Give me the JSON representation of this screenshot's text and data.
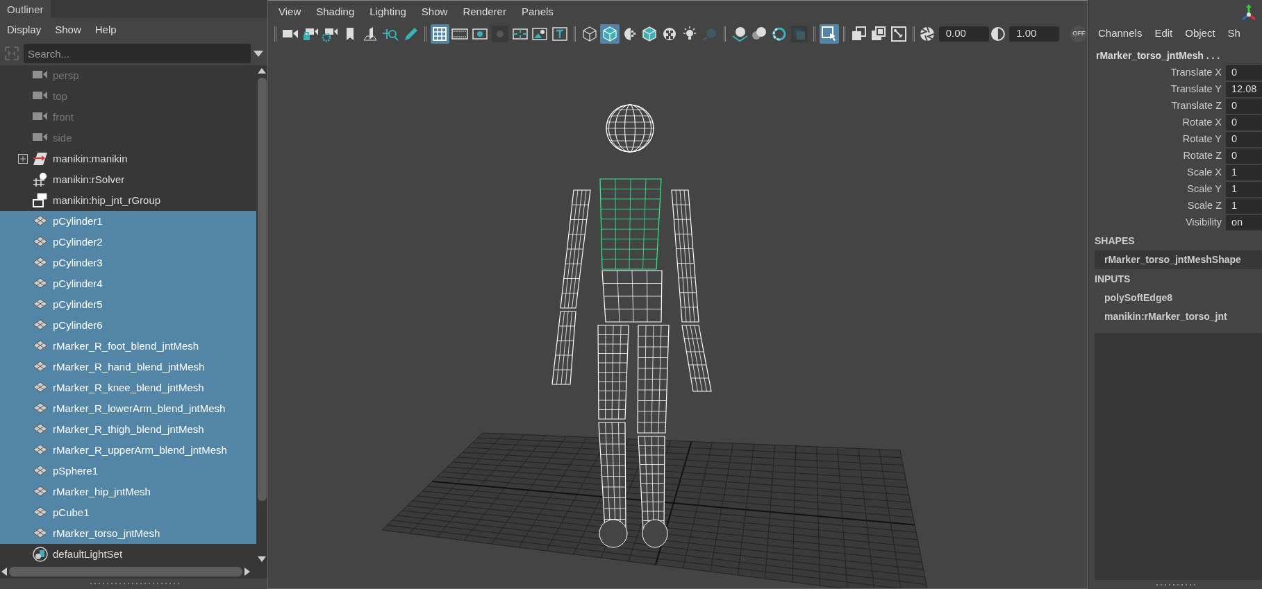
{
  "outliner": {
    "title": "Outliner",
    "menu": [
      "Display",
      "Show",
      "Help"
    ],
    "search": {
      "placeholder": "Search..."
    },
    "items": [
      {
        "label": "persp",
        "kind": "camera",
        "dimmed": true,
        "has_children": false,
        "selected": false
      },
      {
        "label": "top",
        "kind": "camera",
        "dimmed": true,
        "has_children": false,
        "selected": false
      },
      {
        "label": "front",
        "kind": "camera",
        "dimmed": true,
        "has_children": false,
        "selected": false
      },
      {
        "label": "side",
        "kind": "camera",
        "dimmed": true,
        "has_children": false,
        "selected": false
      },
      {
        "label": "manikin:manikin",
        "kind": "locator",
        "dimmed": false,
        "has_children": true,
        "selected": false
      },
      {
        "label": "manikin:rSolver",
        "kind": "solver",
        "dimmed": false,
        "has_children": false,
        "selected": false
      },
      {
        "label": "manikin:hip_jnt_rGroup",
        "kind": "group",
        "dimmed": false,
        "has_children": false,
        "selected": false
      },
      {
        "label": "pCylinder1",
        "kind": "mesh",
        "dimmed": false,
        "has_children": false,
        "selected": true
      },
      {
        "label": "pCylinder2",
        "kind": "mesh",
        "dimmed": false,
        "has_children": false,
        "selected": true
      },
      {
        "label": "pCylinder3",
        "kind": "mesh",
        "dimmed": false,
        "has_children": false,
        "selected": true
      },
      {
        "label": "pCylinder4",
        "kind": "mesh",
        "dimmed": false,
        "has_children": false,
        "selected": true
      },
      {
        "label": "pCylinder5",
        "kind": "mesh",
        "dimmed": false,
        "has_children": false,
        "selected": true
      },
      {
        "label": "pCylinder6",
        "kind": "mesh",
        "dimmed": false,
        "has_children": false,
        "selected": true
      },
      {
        "label": "rMarker_R_foot_blend_jntMesh",
        "kind": "mesh",
        "dimmed": false,
        "has_children": false,
        "selected": true
      },
      {
        "label": "rMarker_R_hand_blend_jntMesh",
        "kind": "mesh",
        "dimmed": false,
        "has_children": false,
        "selected": true
      },
      {
        "label": "rMarker_R_knee_blend_jntMesh",
        "kind": "mesh",
        "dimmed": false,
        "has_children": false,
        "selected": true
      },
      {
        "label": "rMarker_R_lowerArm_blend_jntMesh",
        "kind": "mesh",
        "dimmed": false,
        "has_children": false,
        "selected": true
      },
      {
        "label": "rMarker_R_thigh_blend_jntMesh",
        "kind": "mesh",
        "dimmed": false,
        "has_children": false,
        "selected": true
      },
      {
        "label": "rMarker_R_upperArm_blend_jntMesh",
        "kind": "mesh",
        "dimmed": false,
        "has_children": false,
        "selected": true
      },
      {
        "label": "pSphere1",
        "kind": "mesh",
        "dimmed": false,
        "has_children": false,
        "selected": true
      },
      {
        "label": "rMarker_hip_jntMesh",
        "kind": "mesh",
        "dimmed": false,
        "has_children": false,
        "selected": true
      },
      {
        "label": "pCube1",
        "kind": "mesh",
        "dimmed": false,
        "has_children": false,
        "selected": true
      },
      {
        "label": "rMarker_torso_jntMesh",
        "kind": "mesh",
        "dimmed": false,
        "has_children": false,
        "selected": true
      },
      {
        "label": "defaultLightSet",
        "kind": "lightset",
        "dimmed": false,
        "has_children": false,
        "selected": false
      }
    ]
  },
  "viewport": {
    "menu": [
      "View",
      "Shading",
      "Lighting",
      "Show",
      "Renderer",
      "Panels"
    ],
    "toolbar": [
      {
        "selected": false
      },
      {
        "selected": false
      },
      {
        "selected": false
      },
      {
        "selected": false
      },
      {
        "selected": false
      },
      {
        "selected": false
      },
      {
        "selected": false
      },
      {
        "selected": true
      },
      {
        "selected": false
      },
      {
        "selected": false
      },
      {
        "selected": false
      },
      {
        "selected": false
      },
      {
        "selected": false
      },
      {
        "selected": false
      },
      {
        "selected": false
      },
      {
        "selected": true
      },
      {
        "selected": false
      },
      {
        "selected": false
      },
      {
        "selected": false
      },
      {
        "selected": false
      },
      {
        "selected": false
      },
      {
        "selected": false
      },
      {
        "selected": false
      },
      {
        "selected": false
      },
      {
        "selected": false
      },
      {
        "selected": true
      },
      {
        "selected": false
      },
      {
        "selected": false
      },
      {
        "selected": false
      }
    ],
    "exposure": "0.00",
    "gamma": "1.00",
    "off_label": "OFF"
  },
  "channel_box": {
    "tabs": [
      "Channels",
      "Edit",
      "Object",
      "Sh"
    ],
    "object": "rMarker_torso_jntMesh . . .",
    "attributes": [
      {
        "label": "Translate X",
        "value": "0"
      },
      {
        "label": "Translate Y",
        "value": "12.08"
      },
      {
        "label": "Translate Z",
        "value": "0"
      },
      {
        "label": "Rotate X",
        "value": "0"
      },
      {
        "label": "Rotate Y",
        "value": "0"
      },
      {
        "label": "Rotate Z",
        "value": "0"
      },
      {
        "label": "Scale X",
        "value": "1"
      },
      {
        "label": "Scale Y",
        "value": "1"
      },
      {
        "label": "Scale Z",
        "value": "1"
      },
      {
        "label": "Visibility",
        "value": "on"
      }
    ],
    "shapes_heading": "SHAPES",
    "shapes": [
      {
        "label": "rMarker_torso_jntMeshShape",
        "selected": true
      }
    ],
    "inputs_heading": "INPUTS",
    "inputs": [
      {
        "label": "polySoftEdge8",
        "selected": false
      },
      {
        "label": "manikin:rMarker_torso_jnt",
        "selected": false
      }
    ]
  }
}
